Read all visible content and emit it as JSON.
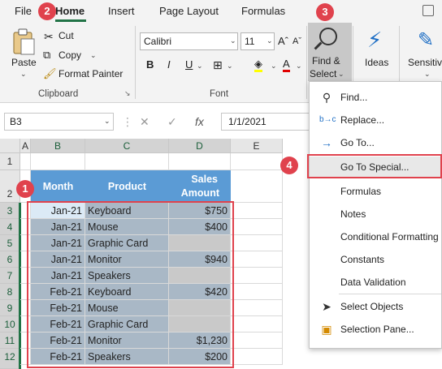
{
  "ribbon_tabs": [
    "File",
    "Home",
    "Insert",
    "Page Layout",
    "Formulas"
  ],
  "clipboard": {
    "paste": "Paste",
    "cut": "Cut",
    "copy": "Copy",
    "format_painter": "Format Painter",
    "group": "Clipboard"
  },
  "font": {
    "name": "Calibri",
    "size": "11",
    "group": "Font"
  },
  "editing": {
    "find_select_line1": "Find &",
    "find_select_line2": "Select",
    "ideas": "Ideas",
    "sensitivity": "Sensitivi"
  },
  "formula_bar": {
    "name_box": "B3",
    "fx": "fx",
    "value": "1/1/2021"
  },
  "columns": [
    "A",
    "B",
    "C",
    "D",
    "E"
  ],
  "rows": [
    "1",
    "2",
    "3",
    "4",
    "5",
    "6",
    "7",
    "8",
    "9",
    "10",
    "11",
    "12"
  ],
  "table": {
    "headers": [
      "Month",
      "Product",
      "Sales",
      "Amount"
    ],
    "rows": [
      [
        "Jan-21",
        "Keyboard",
        "$750"
      ],
      [
        "Jan-21",
        "Mouse",
        "$400"
      ],
      [
        "Jan-21",
        "Graphic Card",
        ""
      ],
      [
        "Jan-21",
        "Monitor",
        "$940"
      ],
      [
        "Jan-21",
        "Speakers",
        ""
      ],
      [
        "Feb-21",
        "Keyboard",
        "$420"
      ],
      [
        "Feb-21",
        "Mouse",
        ""
      ],
      [
        "Feb-21",
        "Graphic Card",
        ""
      ],
      [
        "Feb-21",
        "Monitor",
        "$1,230"
      ],
      [
        "Feb-21",
        "Speakers",
        "$200"
      ]
    ]
  },
  "menu": [
    "Find...",
    "Replace...",
    "Go To...",
    "Go To Special...",
    "Formulas",
    "Notes",
    "Conditional Formatting",
    "Constants",
    "Data Validation",
    "Select Objects",
    "Selection Pane..."
  ],
  "badges": [
    "1",
    "2",
    "3",
    "4"
  ],
  "colors": {
    "accent_green": "#217346",
    "header_blue": "#5b9bd5",
    "annotation_red": "#e0424d"
  }
}
